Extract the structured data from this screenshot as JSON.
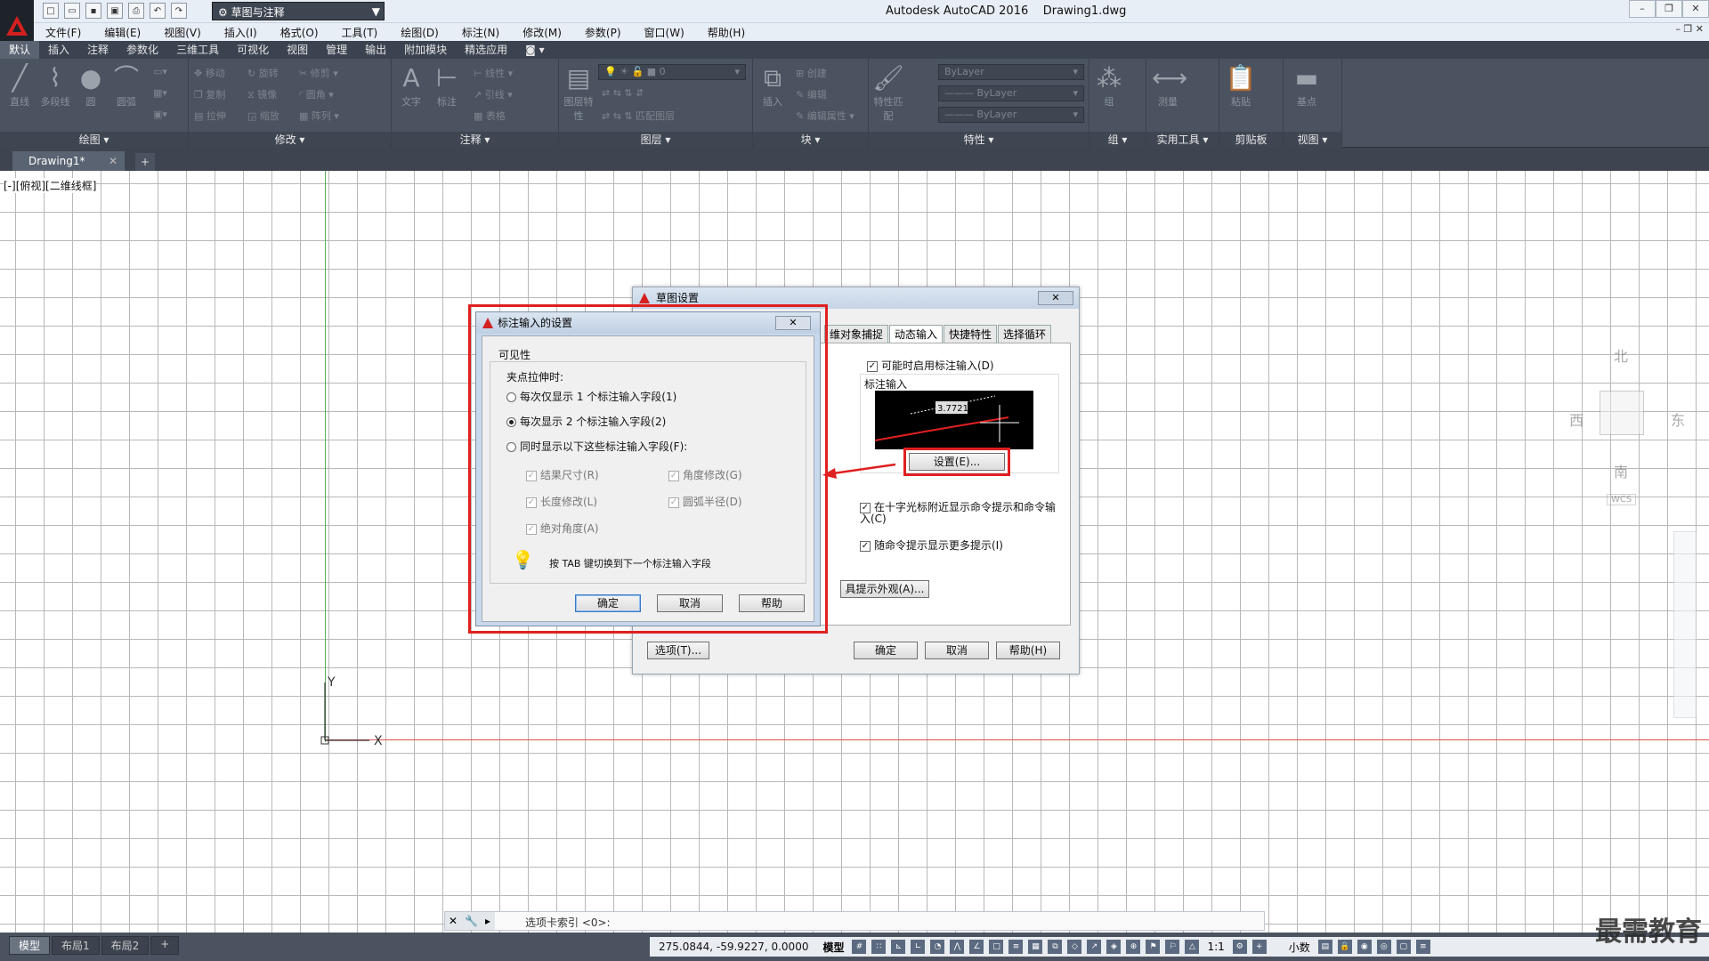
{
  "app": {
    "title": "Autodesk AutoCAD 2016",
    "filename": "Drawing1.dwg",
    "workspace": "草图与注释"
  },
  "menu": [
    "文件(F)",
    "编辑(E)",
    "视图(V)",
    "插入(I)",
    "格式(O)",
    "工具(T)",
    "绘图(D)",
    "标注(N)",
    "修改(M)",
    "参数(P)",
    "窗口(W)",
    "帮助(H)"
  ],
  "ribbon_tabs": [
    "默认",
    "插入",
    "注释",
    "参数化",
    "三维工具",
    "可视化",
    "视图",
    "管理",
    "输出",
    "附加模块",
    "精选应用"
  ],
  "ribbon": {
    "draw": {
      "label": "绘图",
      "line": "直线",
      "polyline": "多段线",
      "circle": "圆",
      "arc": "圆弧"
    },
    "modify": {
      "label": "修改",
      "move": "移动",
      "rotate": "旋转",
      "trim": "修剪",
      "copy": "复制",
      "mirror": "镜像",
      "fillet": "圆角",
      "stretch": "拉伸",
      "scale": "缩放",
      "array": "阵列"
    },
    "annotation": {
      "label": "注释",
      "text": "文字",
      "dimension": "标注",
      "linear": "线性",
      "leader": "引线",
      "table": "表格"
    },
    "layers": {
      "label": "图层",
      "props": "图层特性",
      "current": "0",
      "match": "匹配图层"
    },
    "block": {
      "label": "块",
      "insert": "插入",
      "create": "创建",
      "edit": "编辑",
      "edit_attr": "编辑属性"
    },
    "properties": {
      "label": "特性",
      "match": "特性匹配",
      "bylayer1": "ByLayer",
      "bylayer2": "ByLayer",
      "bylayer3": "ByLayer"
    },
    "groups": {
      "label": "组",
      "group": "组"
    },
    "utilities": {
      "label": "实用工具",
      "measure": "测量"
    },
    "clipboard": {
      "label": "剪贴板",
      "paste": "粘贴"
    },
    "view": {
      "label": "视图",
      "base": "基点"
    }
  },
  "doc_tab": {
    "name": "Drawing1*"
  },
  "viewport_label": "[-][俯视][二维线框]",
  "viewcube": {
    "north": "北",
    "south": "南",
    "east": "东",
    "west": "西",
    "wcs": "WCS"
  },
  "ucs": {
    "x": "X",
    "y": "Y"
  },
  "dlg_draft": {
    "title": "草图设置",
    "tabs": [
      "维对象捕捉",
      "动态输入",
      "快捷特性",
      "选择循环"
    ],
    "enable_dim_input": "可能时启用标注输入(D)",
    "dim_input_group": "标注输入",
    "preview_value": "3.7721",
    "settings_btn": "设置(E)...",
    "show_prompts": "在十字光标附近显示命令提示和命令输入(C)",
    "more_prompts": "随命令提示显示更多提示(I)",
    "appearance_btn": "具提示外观(A)...",
    "options_btn": "选项(T)...",
    "ok": "确定",
    "cancel": "取消",
    "help": "帮助(H)"
  },
  "dlg_dim": {
    "title": "标注输入的设置",
    "group": "可见性",
    "grip_label": "夹点拉伸时:",
    "opt1": "每次仅显示 1 个标注输入字段(1)",
    "opt2": "每次显示 2 个标注输入字段(2)",
    "opt3": "同时显示以下这些标注输入字段(F):",
    "cb_result": "结果尺寸(R)",
    "cb_angle": "角度修改(G)",
    "cb_length": "长度修改(L)",
    "cb_radius": "圆弧半径(D)",
    "cb_absangle": "绝对角度(A)",
    "tip": "按 TAB 键切换到下一个标注输入字段",
    "ok": "确定",
    "cancel": "取消",
    "help": "帮助",
    "selected_option": 2
  },
  "command_line": {
    "prompt": "选项卡索引 <0>:"
  },
  "layout_tabs": [
    "模型",
    "布局1",
    "布局2"
  ],
  "status": {
    "coords": "275.0844, -59.9227, 0.0000",
    "model": "模型",
    "scale": "1:1",
    "units": "小数"
  },
  "watermark": "最需教育"
}
